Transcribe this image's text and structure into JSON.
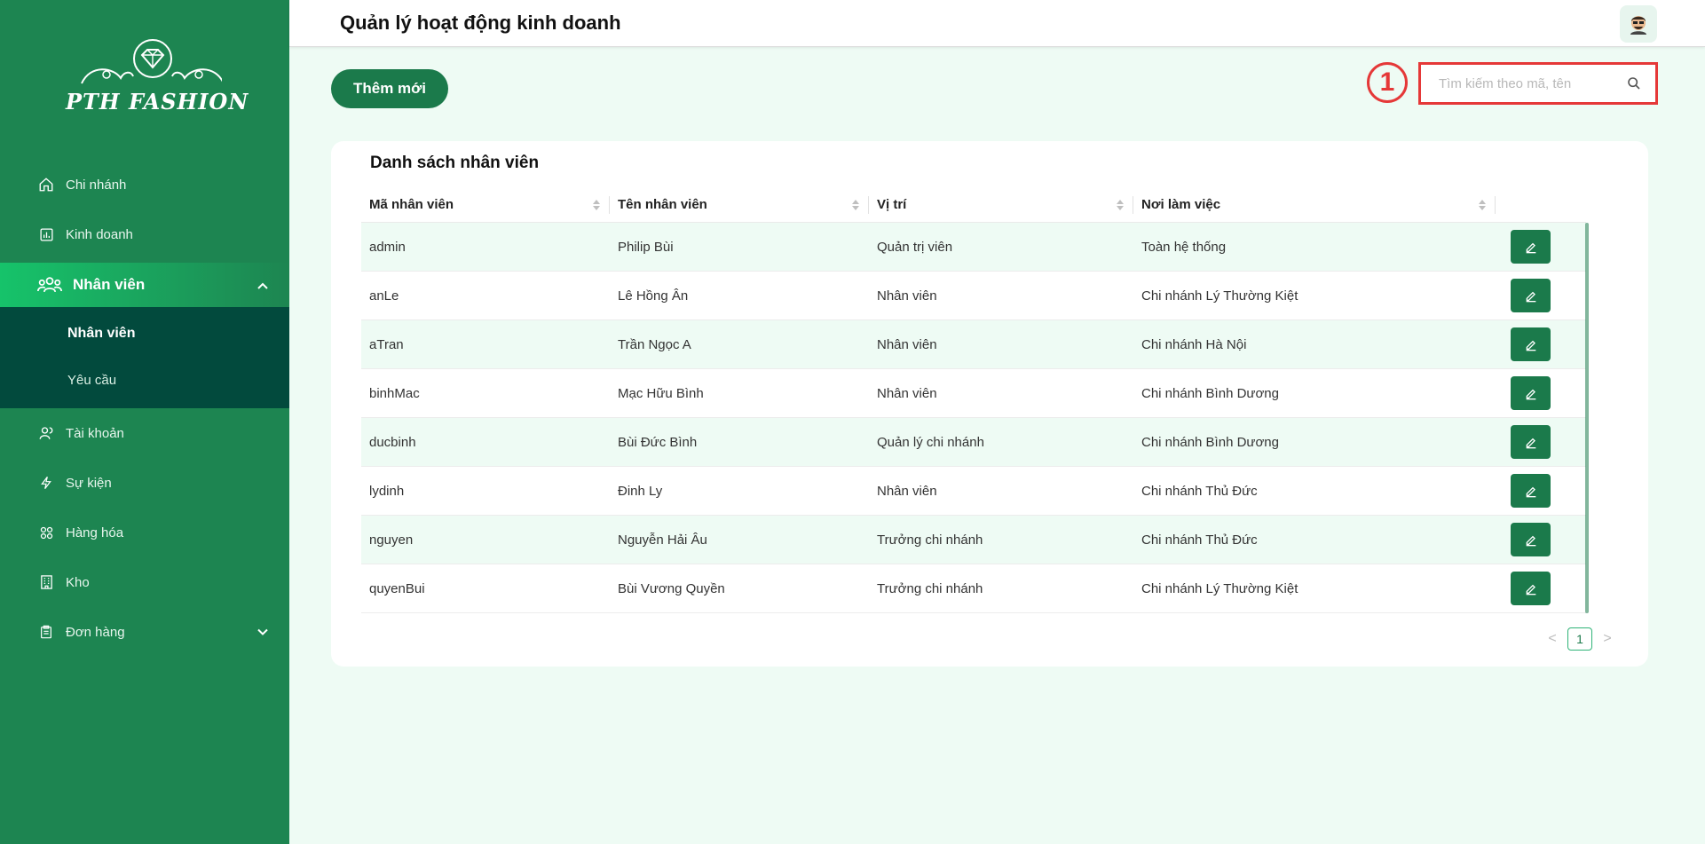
{
  "brand": {
    "logo_text": "PTH FASHION"
  },
  "header": {
    "title": "Quản lý hoạt động kinh doanh"
  },
  "sidebar": {
    "items": [
      {
        "label": "Chi nhánh",
        "icon": "home-icon"
      },
      {
        "label": "Kinh doanh",
        "icon": "chart-icon"
      },
      {
        "label": "Nhân viên",
        "icon": "users-icon",
        "active": true
      },
      {
        "label": "Tài khoản",
        "icon": "user-account-icon"
      },
      {
        "label": "Sự kiện",
        "icon": "lightning-icon"
      },
      {
        "label": "Hàng hóa",
        "icon": "grid-icon"
      },
      {
        "label": "Kho",
        "icon": "building-icon"
      },
      {
        "label": "Đơn hàng",
        "icon": "clipboard-icon"
      }
    ],
    "submenu": [
      {
        "label": "Nhân viên",
        "current": true
      },
      {
        "label": "Yêu cầu"
      }
    ]
  },
  "toolbar": {
    "add_label": "Thêm mới",
    "search_placeholder": "Tìm kiếm theo mã, tên",
    "annotation_number": "1"
  },
  "table": {
    "title": "Danh sách nhân viên",
    "columns": [
      "Mã nhân viên",
      "Tên nhân viên",
      "Vị trí",
      "Nơi làm việc"
    ],
    "rows": [
      [
        "admin",
        "Philip Bùi",
        "Quản trị viên",
        "Toàn hệ thống"
      ],
      [
        "anLe",
        "Lê Hồng Ân",
        "Nhân viên",
        "Chi nhánh Lý Thường Kiệt"
      ],
      [
        "aTran",
        "Trần Ngọc A",
        "Nhân viên",
        "Chi nhánh Hà Nội"
      ],
      [
        "binhMac",
        "Mạc Hữu Bình",
        "Nhân viên",
        "Chi nhánh Bình Dương"
      ],
      [
        "ducbinh",
        "Bùi Đức Bình",
        "Quản lý chi nhánh",
        "Chi nhánh Bình Dương"
      ],
      [
        "lydinh",
        "Đinh Ly",
        "Nhân viên",
        "Chi nhánh Thủ Đức"
      ],
      [
        "nguyen",
        "Nguyễn Hải Âu",
        "Trưởng chi nhánh",
        "Chi nhánh Thủ Đức"
      ],
      [
        "quyenBui",
        "Bùi Vương Quyền",
        "Trưởng chi nhánh",
        "Chi nhánh Lý Thường Kiệt"
      ]
    ]
  },
  "pagination": {
    "current_page": "1",
    "prev": "<",
    "next": ">"
  },
  "colors": {
    "sidebar": "#1d8551",
    "primary": "#1b7a4b",
    "submenu_bg": "#024a3d",
    "page_bg": "#eefbf4",
    "annotation": "#e53838"
  }
}
